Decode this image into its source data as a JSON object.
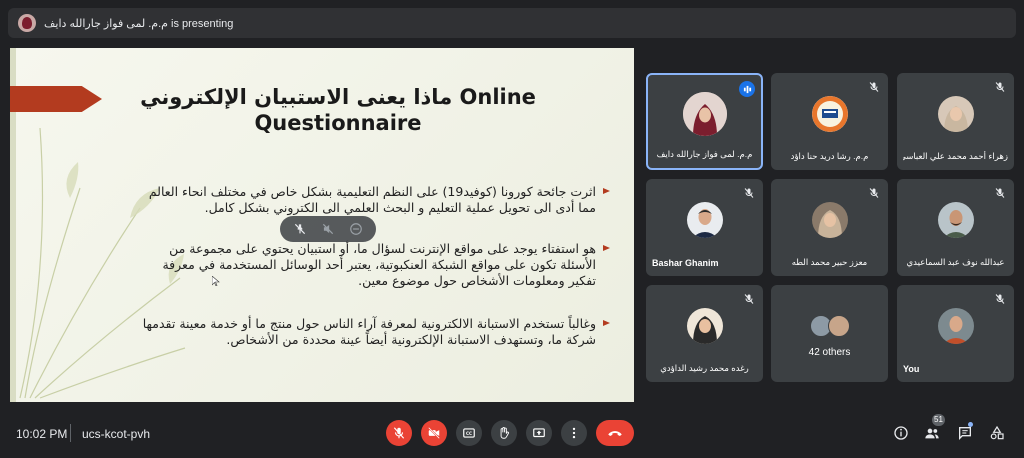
{
  "presenting_bar": {
    "text": "م.م. لمى فواز جارالله دايف is presenting"
  },
  "slide": {
    "title_line1": "ماذا يعنى الاستبيان الإلكتروني  Online",
    "title_line2": "Questionnaire",
    "bullets": [
      "اثرت جائحة كورونا (كوفيد19) على النظم التعليمية بشكل خاص في مختلف انحاء العالم مما أدى الى تحويل عملية التعليم و البحث العلمي الى الكتروني بشكل كامل.",
      "هو استفتاء يوجد على مواقع الإنترنت لسؤال ما، أو استبيان يحتوي على مجموعة من الأسئلة تكون على مواقع الشبكة العنكبوتية، يعتبر أحد الوسائل المستخدمة في معرفة تفكير ومعلومات الأشخاص حول موضوع معين.",
      "وغالباً تستخدم الاستبانة الالكترونية  لمعرفة آراء الناس حول منتج ما أو خدمة معينة تقدمها شركة ما، وتستهدف الاستبانة الإلكترونية أيضاً عينة محددة من الأشخاص."
    ]
  },
  "participants": [
    {
      "name": "م.م. لمى فواز جارالله دايف",
      "speaking": true
    },
    {
      "name": "م.م. رشا دريد حنا داؤد",
      "muted": true
    },
    {
      "name": "زهراء أحمد محمد علي العباسي",
      "muted": true
    },
    {
      "name": "Bashar Ghanim",
      "muted": true
    },
    {
      "name": "معزز حبير محمد الطه",
      "muted": true
    },
    {
      "name": "عبدالله نوف عبد السماعيدي",
      "muted": true
    },
    {
      "name": "رغده محمد رشيد الداؤدي",
      "muted": true
    },
    {
      "name": "42 others",
      "muted": true
    },
    {
      "name": "You",
      "muted": true
    }
  ],
  "bottom_bar": {
    "time": "10:02 PM",
    "separator": "|",
    "meeting_code": "ucs-kcot-pvh",
    "participant_count": "51"
  },
  "colors": {
    "background": "#202124",
    "tile": "#3c4043",
    "danger": "#ea4335",
    "accent": "#8ab4f8",
    "slide_accent": "#b33b1f"
  }
}
